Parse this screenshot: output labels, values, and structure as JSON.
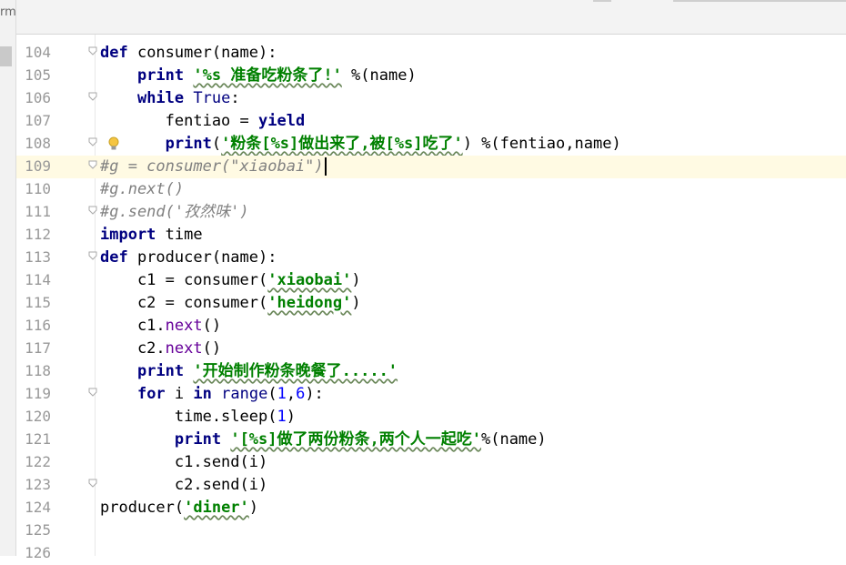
{
  "left_panel": {
    "tab_label": "rm"
  },
  "colors": {
    "keyword": "#000080",
    "string": "#008000",
    "comment": "#808080",
    "number": "#0000ff",
    "method": "#660099",
    "current_line": "#fffae3",
    "line_number": "#999999"
  },
  "icons": {
    "fold": "fold-icon",
    "hint": "lightbulb-icon"
  },
  "lines": [
    {
      "num": "104",
      "fold": true,
      "tokens": [
        {
          "t": "def",
          "c": "kw"
        },
        {
          "t": " consumer(name):",
          "c": ""
        }
      ]
    },
    {
      "num": "105",
      "fold": false,
      "tokens": [
        {
          "t": "    ",
          "c": ""
        },
        {
          "t": "print",
          "c": "kw"
        },
        {
          "t": " ",
          "c": ""
        },
        {
          "t": "'%s 准备吃粉条了!'",
          "c": "str"
        },
        {
          "t": " %(name)",
          "c": ""
        }
      ]
    },
    {
      "num": "106",
      "fold": true,
      "tokens": [
        {
          "t": "    ",
          "c": ""
        },
        {
          "t": "while",
          "c": "kw"
        },
        {
          "t": " ",
          "c": ""
        },
        {
          "t": "True",
          "c": "bi"
        },
        {
          "t": ":",
          "c": ""
        }
      ]
    },
    {
      "num": "107",
      "fold": false,
      "tokens": [
        {
          "t": "       fentiao = ",
          "c": ""
        },
        {
          "t": "yield",
          "c": "kw"
        }
      ]
    },
    {
      "num": "108",
      "fold": true,
      "bulb": true,
      "tokens": [
        {
          "t": "       ",
          "c": ""
        },
        {
          "t": "print",
          "c": "kw"
        },
        {
          "t": "(",
          "c": ""
        },
        {
          "t": "'粉条[%s]做出来了,被[%s]吃了'",
          "c": "str"
        },
        {
          "t": ") %(fentiao,name)",
          "c": ""
        }
      ]
    },
    {
      "num": "109",
      "fold": true,
      "current": true,
      "caret": true,
      "tokens": [
        {
          "t": "#g = consumer(\"xiaobai\")",
          "c": "cmt"
        }
      ]
    },
    {
      "num": "110",
      "fold": false,
      "tokens": [
        {
          "t": "#g.next()",
          "c": "cmt"
        }
      ]
    },
    {
      "num": "111",
      "fold": true,
      "tokens": [
        {
          "t": "#g.send('孜然味')",
          "c": "cmt"
        }
      ]
    },
    {
      "num": "112",
      "fold": false,
      "tokens": [
        {
          "t": "import",
          "c": "kw"
        },
        {
          "t": " time",
          "c": ""
        }
      ]
    },
    {
      "num": "113",
      "fold": true,
      "tokens": [
        {
          "t": "def",
          "c": "kw"
        },
        {
          "t": " producer(name):",
          "c": ""
        }
      ]
    },
    {
      "num": "114",
      "fold": false,
      "tokens": [
        {
          "t": "    c1 = consumer(",
          "c": ""
        },
        {
          "t": "'xiaobai'",
          "c": "str"
        },
        {
          "t": ")",
          "c": ""
        }
      ]
    },
    {
      "num": "115",
      "fold": false,
      "tokens": [
        {
          "t": "    c2 = consumer(",
          "c": ""
        },
        {
          "t": "'heidong'",
          "c": "str"
        },
        {
          "t": ")",
          "c": ""
        }
      ]
    },
    {
      "num": "116",
      "fold": false,
      "tokens": [
        {
          "t": "    c1.",
          "c": ""
        },
        {
          "t": "next",
          "c": "meth"
        },
        {
          "t": "()",
          "c": ""
        }
      ]
    },
    {
      "num": "117",
      "fold": false,
      "tokens": [
        {
          "t": "    c2.",
          "c": ""
        },
        {
          "t": "next",
          "c": "meth"
        },
        {
          "t": "()",
          "c": ""
        }
      ]
    },
    {
      "num": "118",
      "fold": false,
      "tokens": [
        {
          "t": "    ",
          "c": ""
        },
        {
          "t": "print",
          "c": "kw"
        },
        {
          "t": " ",
          "c": ""
        },
        {
          "t": "'开始制作粉条晚餐了.....'",
          "c": "str"
        }
      ]
    },
    {
      "num": "119",
      "fold": true,
      "tokens": [
        {
          "t": "    ",
          "c": ""
        },
        {
          "t": "for",
          "c": "kw"
        },
        {
          "t": " i ",
          "c": ""
        },
        {
          "t": "in",
          "c": "kw"
        },
        {
          "t": " ",
          "c": ""
        },
        {
          "t": "range",
          "c": "bi"
        },
        {
          "t": "(",
          "c": ""
        },
        {
          "t": "1",
          "c": "num"
        },
        {
          "t": ",",
          "c": ""
        },
        {
          "t": "6",
          "c": "num"
        },
        {
          "t": "):",
          "c": ""
        }
      ]
    },
    {
      "num": "120",
      "fold": false,
      "tokens": [
        {
          "t": "        time.sleep(",
          "c": ""
        },
        {
          "t": "1",
          "c": "num"
        },
        {
          "t": ")",
          "c": ""
        }
      ]
    },
    {
      "num": "121",
      "fold": false,
      "tokens": [
        {
          "t": "        ",
          "c": ""
        },
        {
          "t": "print",
          "c": "kw"
        },
        {
          "t": " ",
          "c": ""
        },
        {
          "t": "'[%s]做了两份粉条,两个人一起吃'",
          "c": "str"
        },
        {
          "t": "%(name)",
          "c": ""
        }
      ]
    },
    {
      "num": "122",
      "fold": false,
      "tokens": [
        {
          "t": "        c1.send(i)",
          "c": ""
        }
      ]
    },
    {
      "num": "123",
      "fold": true,
      "tokens": [
        {
          "t": "        c2.send(i)",
          "c": ""
        }
      ]
    },
    {
      "num": "124",
      "fold": false,
      "tokens": [
        {
          "t": "producer(",
          "c": ""
        },
        {
          "t": "'diner'",
          "c": "str"
        },
        {
          "t": ")",
          "c": ""
        }
      ]
    },
    {
      "num": "125",
      "fold": false,
      "tokens": []
    },
    {
      "num": "126",
      "fold": false,
      "tokens": []
    }
  ]
}
